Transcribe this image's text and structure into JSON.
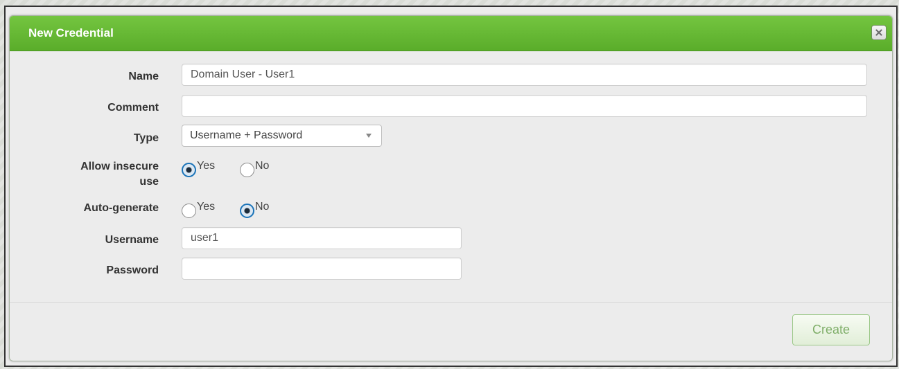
{
  "dialog": {
    "title": "New Credential",
    "close_icon": "close-x-icon"
  },
  "form": {
    "name": {
      "label": "Name",
      "value": "Domain User - User1",
      "placeholder": ""
    },
    "comment": {
      "label": "Comment",
      "value": "",
      "placeholder": ""
    },
    "type": {
      "label": "Type",
      "selected": "Username + Password",
      "icon": "chevron-down-icon"
    },
    "allow_insecure": {
      "label_line1": "Allow insecure",
      "label_line2": "use",
      "options": [
        {
          "label": "Yes",
          "checked": true
        },
        {
          "label": "No",
          "checked": false
        }
      ]
    },
    "auto_generate": {
      "label": "Auto-generate",
      "options": [
        {
          "label": "Yes",
          "checked": false
        },
        {
          "label": "No",
          "checked": true
        }
      ]
    },
    "username": {
      "label": "Username",
      "value": "user1",
      "placeholder": ""
    },
    "password": {
      "label": "Password",
      "value": "",
      "placeholder": ""
    }
  },
  "footer": {
    "create_label": "Create"
  },
  "colors": {
    "titlebar_top": "#74c540",
    "titlebar_bottom": "#5aad2a",
    "radio_checked": "#1a73b8",
    "create_text": "#7fae68"
  }
}
